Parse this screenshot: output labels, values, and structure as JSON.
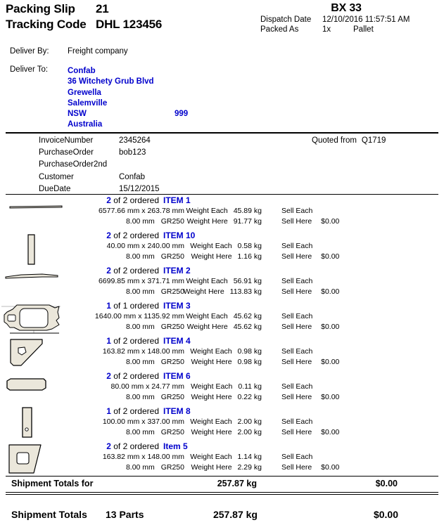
{
  "header": {
    "packing_slip_label": "Packing Slip",
    "packing_slip_number": "21",
    "tracking_code_label": "Tracking Code",
    "tracking_code_value": "DHL 123456",
    "box_id": "BX 33",
    "dispatch_date_label": "Dispatch Date",
    "dispatch_date_value": "12/10/2016 11:57:51 AM",
    "packed_as_label": "Packed As",
    "packed_as_qty": "1x",
    "packed_as_type": "Pallet"
  },
  "delivery": {
    "deliver_by_label": "Deliver By:",
    "deliver_by_value": "Freight company",
    "deliver_to_label": "Deliver To:",
    "address": {
      "name": "Confab",
      "street": "36 Witchety Grub Blvd",
      "suburb": "Grewella",
      "city": "Salemville",
      "state": "NSW",
      "postcode": "999",
      "country": "Australia"
    }
  },
  "meta": {
    "rows": [
      {
        "key": "InvoiceNumber",
        "value": "2345264"
      },
      {
        "key": "PurchaseOrder",
        "value": "bob123"
      },
      {
        "key": "PurchaseOrder2nd",
        "value": ""
      },
      {
        "key": "Customer",
        "value": "Confab"
      },
      {
        "key": "DueDate",
        "value": "15/12/2015"
      }
    ],
    "quoted_from_label": "Quoted from",
    "quoted_from_value": "Q1719"
  },
  "labels": {
    "of": "of",
    "ordered": "ordered",
    "mm": "mm",
    "times": "x",
    "weight_each": "Weight Each",
    "weight_here": "Weight Here",
    "sell_each": "Sell Each",
    "sell_here": "Sell Here"
  },
  "items": [
    {
      "qty_packed": "2",
      "qty_ordered": "2",
      "name": "ITEM 1",
      "length": "6577.66",
      "width": "263.78",
      "thickness": "8.00",
      "grade": "GR250",
      "weight_each": "45.89 kg",
      "weight_here": "91.77 kg",
      "sell_here": "$0.00",
      "shape": "long-thin-strip"
    },
    {
      "qty_packed": "2",
      "qty_ordered": "2",
      "name": "ITEM 10",
      "length": "40.00",
      "width": "240.00",
      "thickness": "8.00",
      "grade": "GR250",
      "weight_each": "0.58 kg",
      "weight_here": "1.16 kg",
      "sell_here": "$0.00",
      "shape": "vertical-bar"
    },
    {
      "qty_packed": "2",
      "qty_ordered": "2",
      "name": "ITEM 2",
      "length": "6699.85",
      "width": "371.71",
      "thickness": "8.00",
      "grade": "GR250",
      "weight_each": "56.91 kg",
      "weight_here": "113.83 kg",
      "sell_here": "$0.00",
      "shape": "tapered-strip"
    },
    {
      "qty_packed": "1",
      "qty_ordered": "1",
      "name": "ITEM 3",
      "length": "1640.00",
      "width": "1135.92",
      "thickness": "8.00",
      "grade": "GR250",
      "weight_each": "45.62 kg",
      "weight_here": "45.62 kg",
      "sell_here": "$0.00",
      "shape": "gasket-frame"
    },
    {
      "qty_packed": "1",
      "qty_ordered": "2",
      "name": "ITEM 4",
      "length": "163.82",
      "width": "148.00",
      "thickness": "8.00",
      "grade": "GR250",
      "weight_each": "0.98 kg",
      "weight_here": "0.98 kg",
      "sell_here": "$0.00",
      "shape": "chamfered-plate-small-hole"
    },
    {
      "qty_packed": "2",
      "qty_ordered": "2",
      "name": "ITEM 6",
      "length": "80.00",
      "width": "24.77",
      "thickness": "8.00",
      "grade": "GR250",
      "weight_each": "0.11 kg",
      "weight_here": "0.22 kg",
      "sell_here": "$0.00",
      "shape": "wide-flat-bar"
    },
    {
      "qty_packed": "1",
      "qty_ordered": "2",
      "name": "ITEM 8",
      "length": "100.00",
      "width": "337.00",
      "thickness": "8.00",
      "grade": "GR250",
      "weight_each": "2.00 kg",
      "weight_here": "2.00 kg",
      "sell_here": "$0.00",
      "shape": "tall-bar-hole"
    },
    {
      "qty_packed": "2",
      "qty_ordered": "2",
      "name": "Item 5",
      "length": "163.82",
      "width": "148.00",
      "thickness": "8.00",
      "grade": "GR250",
      "weight_each": "1.14 kg",
      "weight_here": "2.29 kg",
      "sell_here": "$0.00",
      "shape": "trapezoid-square-hole"
    }
  ],
  "totals": {
    "subtotal_label": "Shipment Totals for",
    "subtotal_weight": "257.87 kg",
    "subtotal_price": "$0.00",
    "final_label": "Shipment Totals",
    "final_parts": "13 Parts",
    "final_weight": "257.87 kg",
    "final_price": "$0.00"
  },
  "colors": {
    "accent_blue": "#0000cc",
    "part_fill": "#ebe7db",
    "part_stroke": "#000000"
  }
}
